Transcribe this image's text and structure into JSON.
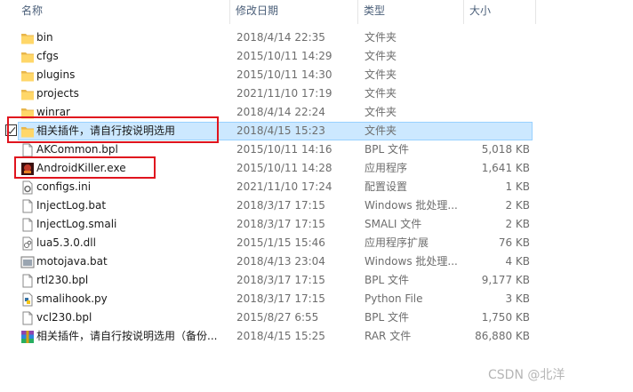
{
  "columns": {
    "name": "名称",
    "date": "修改日期",
    "type": "类型",
    "size": "大小"
  },
  "files": [
    {
      "name": "bin",
      "date": "2018/4/14 22:35",
      "type": "文件夹",
      "size": "",
      "icon": "folder-icon"
    },
    {
      "name": "cfgs",
      "date": "2015/10/11 14:29",
      "type": "文件夹",
      "size": "",
      "icon": "folder-icon"
    },
    {
      "name": "plugins",
      "date": "2015/10/11 14:30",
      "type": "文件夹",
      "size": "",
      "icon": "folder-icon"
    },
    {
      "name": "projects",
      "date": "2021/11/10 17:19",
      "type": "文件夹",
      "size": "",
      "icon": "folder-icon"
    },
    {
      "name": "winrar",
      "date": "2018/4/14 22:24",
      "type": "文件夹",
      "size": "",
      "icon": "folder-icon"
    },
    {
      "name": "相关插件，请自行按说明选用",
      "date": "2018/4/15 15:23",
      "type": "文件夹",
      "size": "",
      "icon": "folder-icon"
    },
    {
      "name": "AKCommon.bpl",
      "date": "2015/10/11 14:16",
      "type": "BPL 文件",
      "size": "5,018 KB",
      "icon": "file-icon"
    },
    {
      "name": "AndroidKiller.exe",
      "date": "2015/10/11 14:28",
      "type": "应用程序",
      "size": "1,641 KB",
      "icon": "app-icon"
    },
    {
      "name": "configs.ini",
      "date": "2021/11/10 17:24",
      "type": "配置设置",
      "size": "1 KB",
      "icon": "settings-file-icon"
    },
    {
      "name": "InjectLog.bat",
      "date": "2018/3/17 17:15",
      "type": "Windows 批处理...",
      "size": "2 KB",
      "icon": "file-icon"
    },
    {
      "name": "InjectLog.smali",
      "date": "2018/3/17 17:15",
      "type": "SMALI 文件",
      "size": "2 KB",
      "icon": "file-icon"
    },
    {
      "name": "lua5.3.0.dll",
      "date": "2015/1/15 15:46",
      "type": "应用程序扩展",
      "size": "76 KB",
      "icon": "dll-icon"
    },
    {
      "name": "motojava.bat",
      "date": "2018/4/13 23:04",
      "type": "Windows 批处理...",
      "size": "4 KB",
      "icon": "batch-icon"
    },
    {
      "name": "rtl230.bpl",
      "date": "2018/3/17 17:15",
      "type": "BPL 文件",
      "size": "9,177 KB",
      "icon": "file-icon"
    },
    {
      "name": "smalihook.py",
      "date": "2018/3/17 17:15",
      "type": "Python File",
      "size": "3 KB",
      "icon": "python-icon"
    },
    {
      "name": "vcl230.bpl",
      "date": "2015/8/27 6:55",
      "type": "BPL 文件",
      "size": "1,750 KB",
      "icon": "file-icon"
    },
    {
      "name": "相关插件，请自行按说明选用（备份...",
      "date": "2018/4/15 15:25",
      "type": "RAR 文件",
      "size": "86,880 KB",
      "icon": "rar-icon"
    }
  ],
  "selected_index": 5,
  "highlight_color": "#e0141e",
  "watermark": "CSDN @北洋"
}
